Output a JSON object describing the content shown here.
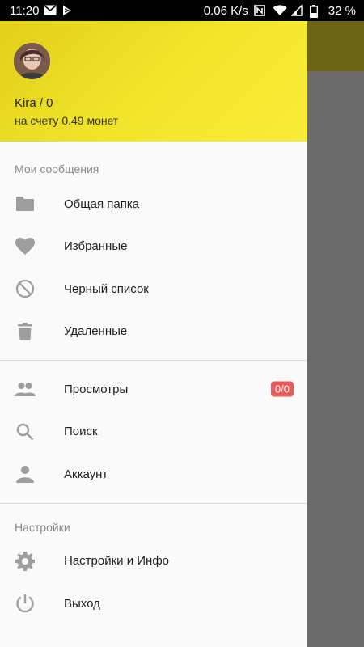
{
  "status_bar": {
    "time": "11:20",
    "network_speed": "0.06 K/s",
    "battery": "32 %",
    "left_icons": [
      "mail-icon",
      "notification-icon"
    ],
    "right_icons": [
      "nfc-icon",
      "wifi-icon",
      "signal-icon",
      "battery-icon"
    ]
  },
  "drawer": {
    "header": {
      "user_name": "Kira / 0",
      "balance": "на счету 0.49 монет",
      "colors": {
        "start": "#e2cf1a",
        "end": "#f8ec3a"
      }
    },
    "sections": [
      {
        "title": "Мои сообщения",
        "items": [
          {
            "label": "Общая папка",
            "icon": "folder-icon"
          },
          {
            "label": "Избранные",
            "icon": "heart-icon"
          },
          {
            "label": "Черный список",
            "icon": "block-icon"
          },
          {
            "label": "Удаленные",
            "icon": "trash-icon"
          }
        ]
      },
      {
        "title": "",
        "items": [
          {
            "label": "Просмотры",
            "icon": "people-icon",
            "badge": "0/0"
          },
          {
            "label": "Поиск",
            "icon": "search-icon"
          },
          {
            "label": "Аккаунт",
            "icon": "person-icon"
          }
        ]
      },
      {
        "title": "Настройки",
        "items": [
          {
            "label": "Настройки и Инфо",
            "icon": "gear-icon"
          },
          {
            "label": "Выход",
            "icon": "power-icon"
          }
        ]
      }
    ]
  },
  "colors": {
    "badge": "#e95a5a",
    "icon": "#9e9e9e",
    "scrim": "#6b6b6b",
    "appbar_dimmed": "#6c6518"
  }
}
